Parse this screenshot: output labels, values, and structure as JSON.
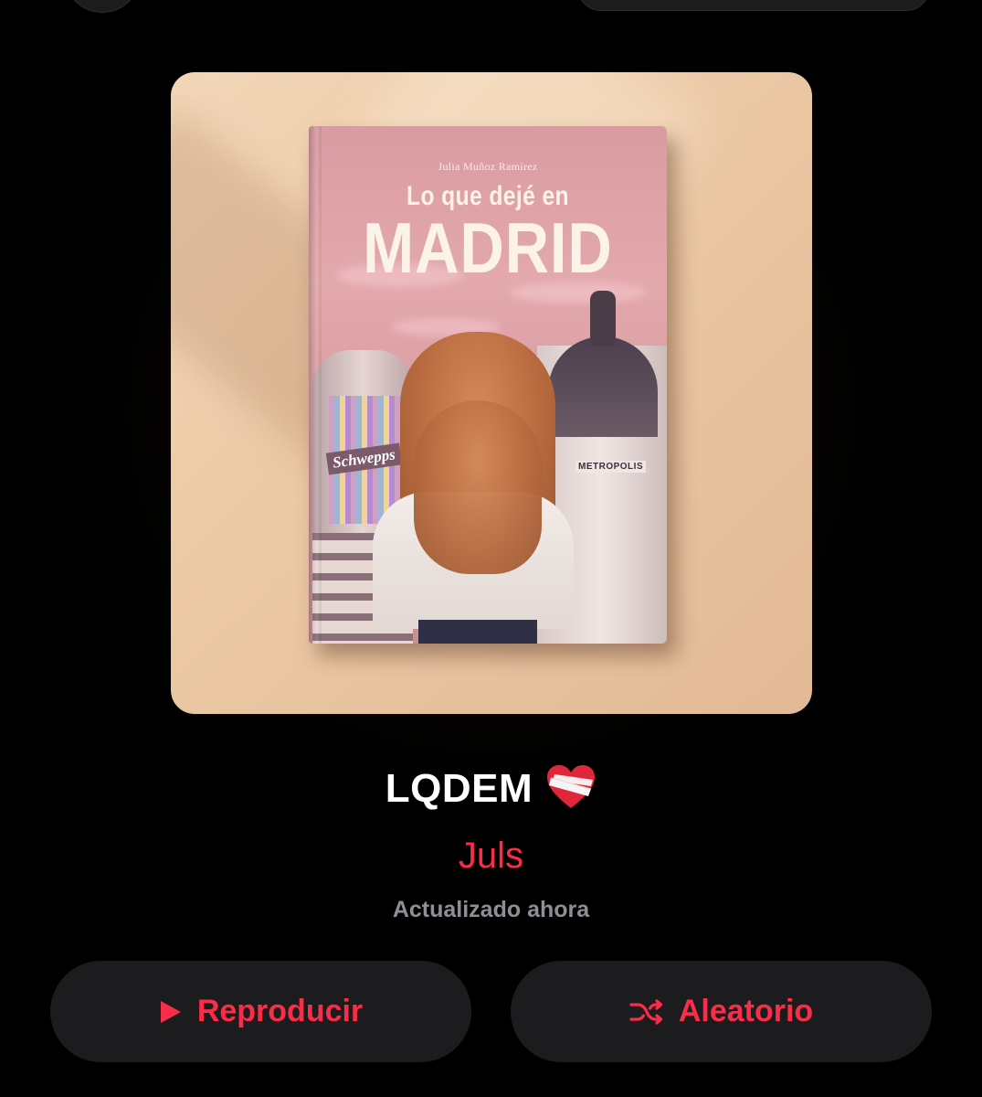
{
  "artwork": {
    "book_author": "Julia Muñoz Ramírez",
    "book_title_line1": "Lo que dejé en",
    "book_title_line2": "MADRID",
    "sign_left": "Schwepps",
    "sign_right": "METROPOLIS"
  },
  "playlist": {
    "title": "LQDEM",
    "title_emoji": "mending-heart-icon",
    "curator": "Juls",
    "status": "Actualizado ahora"
  },
  "actions": {
    "play_label": "Reproducir",
    "shuffle_label": "Aleatorio"
  },
  "colors": {
    "accent": "#fa2d48",
    "background": "#000000",
    "button_bg": "#1c1c1e",
    "secondary_text": "#8e8e93"
  }
}
